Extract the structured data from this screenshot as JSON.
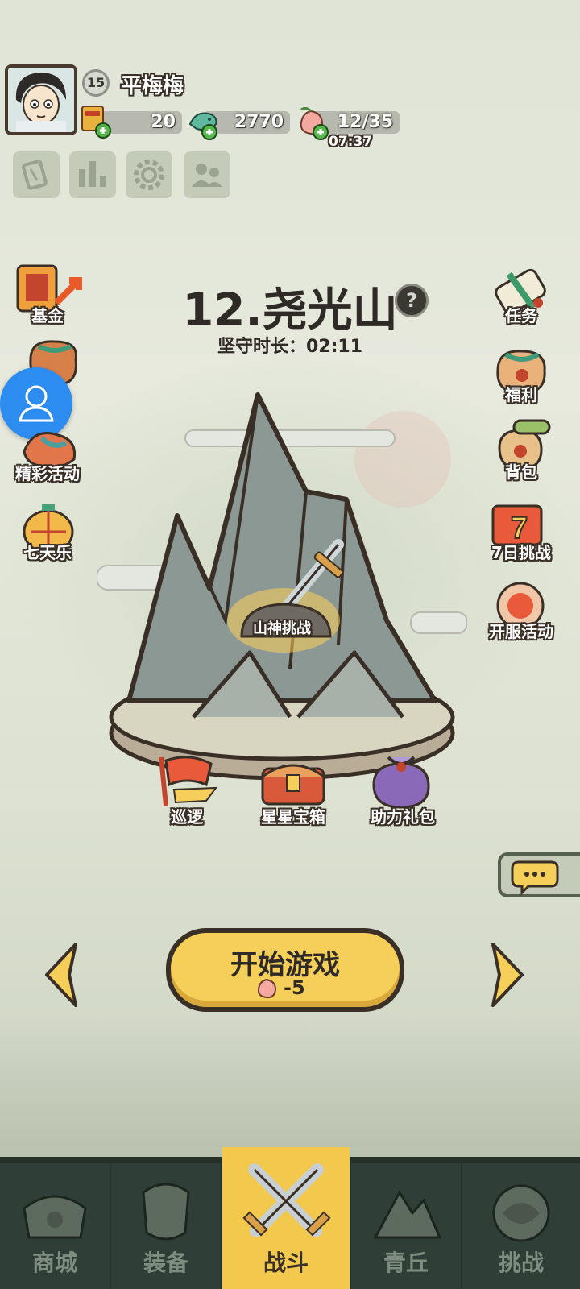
{
  "player": {
    "level": "15",
    "name": "平梅梅"
  },
  "resources": {
    "tickets": "20",
    "jade": "2770",
    "stamina": "12/35",
    "stamina_timer": "07:37"
  },
  "toolbar_icons": [
    "card-icon",
    "ranking-icon",
    "settings-gear-icon",
    "friends-icon"
  ],
  "stage": {
    "title": "12.尧光山",
    "guard_label": "坚守时长：02:11",
    "boss_label": "山神挑战"
  },
  "left_menu": [
    {
      "label": "基金",
      "icon": "fund-icon"
    },
    {
      "label": "",
      "icon": "gift-pouch-icon"
    },
    {
      "label": "精彩活动",
      "icon": "dragon-event-icon"
    },
    {
      "label": "七天乐",
      "icon": "lantern-icon"
    }
  ],
  "right_menu": [
    {
      "label": "任务",
      "icon": "scroll-task-icon"
    },
    {
      "label": "福利",
      "icon": "welfare-bag-icon"
    },
    {
      "label": "背包",
      "icon": "backpack-icon"
    },
    {
      "label": "7日挑战",
      "icon": "seven-day-challenge-icon"
    },
    {
      "label": "开服活动",
      "icon": "server-event-icon"
    }
  ],
  "platform_items": [
    {
      "label": "巡逻",
      "icon": "patrol-flag-icon"
    },
    {
      "label": "星星宝箱",
      "icon": "star-chest-icon"
    },
    {
      "label": "助力礼包",
      "icon": "help-gift-bag-icon"
    }
  ],
  "start": {
    "label": "开始游戏",
    "cost": "-5"
  },
  "bottom_nav": [
    {
      "label": "商城",
      "icon": "shop-icon",
      "active": false
    },
    {
      "label": "装备",
      "icon": "armor-icon",
      "active": false
    },
    {
      "label": "战斗",
      "icon": "crossed-swords-icon",
      "active": true
    },
    {
      "label": "青丘",
      "icon": "mountain-icon",
      "active": false
    },
    {
      "label": "挑战",
      "icon": "challenge-orb-icon",
      "active": false
    }
  ],
  "colors": {
    "accent_yellow": "#f5cf5a",
    "nav_bg": "#2f3f37",
    "nav_active": "#f2c94c",
    "dark_outline": "#3a2f26"
  }
}
